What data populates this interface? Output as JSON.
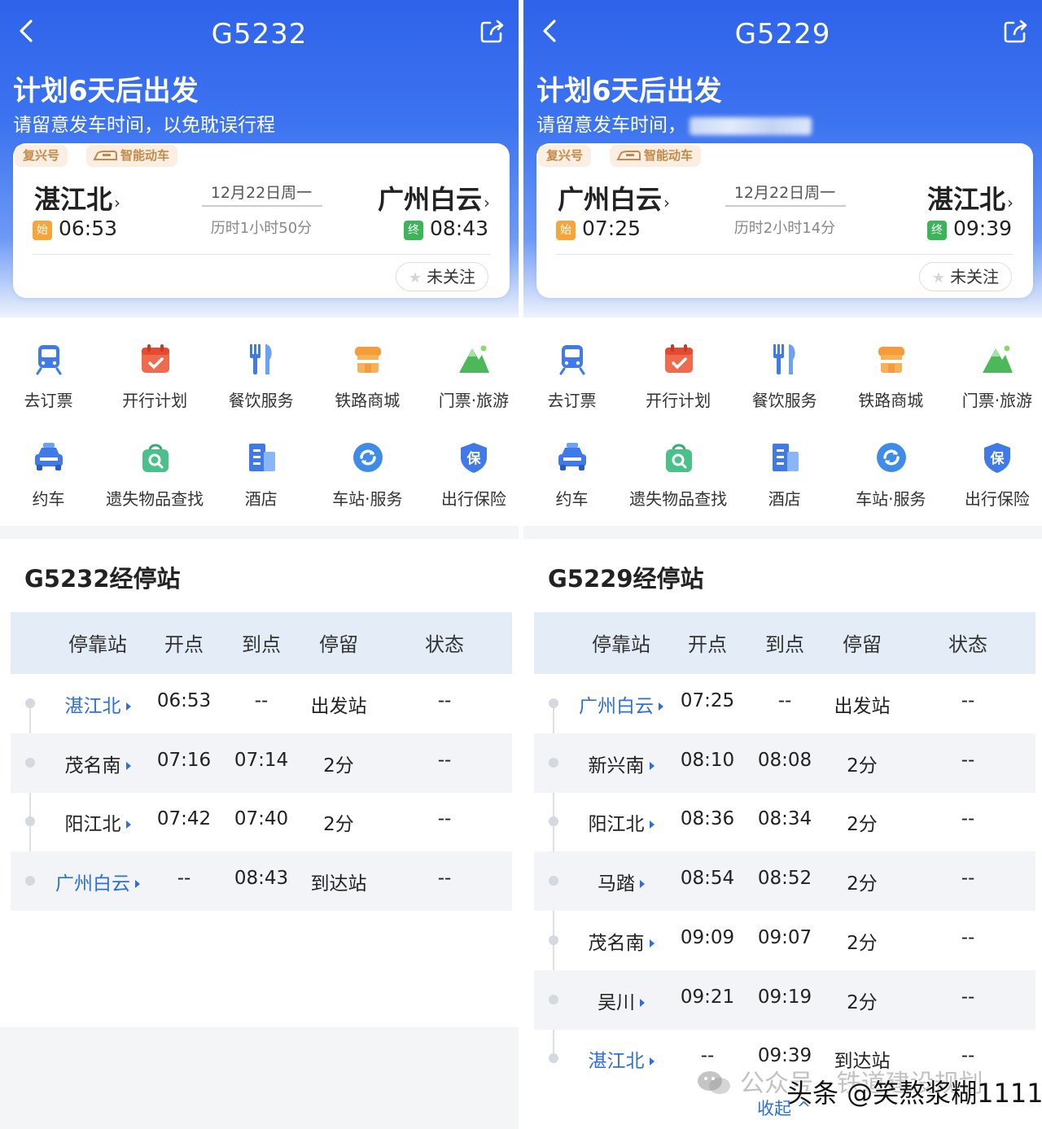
{
  "panels": [
    {
      "train_no": "G5232",
      "headline": "计划6天后出发",
      "subline": "请留意发车时间，以免耽误行程",
      "subline_blurred": false,
      "tags": [
        "复兴号",
        "智能动车"
      ],
      "from_station": "湛江北",
      "to_station": "广州白云",
      "depart_badge": "始",
      "arrive_badge": "终",
      "depart_time": "06:53",
      "arrive_time": "08:43",
      "date": "12月22日周一",
      "duration": "历时1小时50分",
      "follow_label": "未关注",
      "services": [
        "去订票",
        "开行计划",
        "餐饮服务",
        "铁路商城",
        "门票·旅游",
        "约车",
        "遗失物品查找",
        "酒店",
        "车站·服务",
        "出行保险"
      ],
      "stops_title": "G5232经停站",
      "table_headers": [
        "停靠站",
        "开点",
        "到点",
        "停留",
        "状态"
      ],
      "stops": [
        {
          "name": "湛江北",
          "depart": "06:53",
          "arrive": "--",
          "stay": "出发站",
          "status": "--",
          "highlight": true
        },
        {
          "name": "茂名南",
          "depart": "07:16",
          "arrive": "07:14",
          "stay": "2分",
          "status": "--",
          "highlight": false
        },
        {
          "name": "阳江北",
          "depart": "07:42",
          "arrive": "07:40",
          "stay": "2分",
          "status": "--",
          "highlight": false
        },
        {
          "name": "广州白云",
          "depart": "--",
          "arrive": "08:43",
          "stay": "到达站",
          "status": "--",
          "highlight": true
        }
      ]
    },
    {
      "train_no": "G5229",
      "headline": "计划6天后出发",
      "subline": "请留意发车时间，",
      "subline_blurred": true,
      "tags": [
        "复兴号",
        "智能动车"
      ],
      "from_station": "广州白云",
      "to_station": "湛江北",
      "depart_badge": "始",
      "arrive_badge": "终",
      "depart_time": "07:25",
      "arrive_time": "09:39",
      "date": "12月22日周一",
      "duration": "历时2小时14分",
      "follow_label": "未关注",
      "services": [
        "去订票",
        "开行计划",
        "餐饮服务",
        "铁路商城",
        "门票·旅游",
        "约车",
        "遗失物品查找",
        "酒店",
        "车站·服务",
        "出行保险"
      ],
      "stops_title": "G5229经停站",
      "table_headers": [
        "停靠站",
        "开点",
        "到点",
        "停留",
        "状态"
      ],
      "stops": [
        {
          "name": "广州白云",
          "depart": "07:25",
          "arrive": "--",
          "stay": "出发站",
          "status": "--",
          "highlight": true
        },
        {
          "name": "新兴南",
          "depart": "08:10",
          "arrive": "08:08",
          "stay": "2分",
          "status": "--",
          "highlight": false
        },
        {
          "name": "阳江北",
          "depart": "08:36",
          "arrive": "08:34",
          "stay": "2分",
          "status": "--",
          "highlight": false
        },
        {
          "name": "马踏",
          "depart": "08:54",
          "arrive": "08:52",
          "stay": "2分",
          "status": "--",
          "highlight": false
        },
        {
          "name": "茂名南",
          "depart": "09:09",
          "arrive": "09:07",
          "stay": "2分",
          "status": "--",
          "highlight": false
        },
        {
          "name": "吴川",
          "depart": "09:21",
          "arrive": "09:19",
          "stay": "2分",
          "status": "--",
          "highlight": false
        },
        {
          "name": "湛江北",
          "depart": "--",
          "arrive": "09:39",
          "stay": "到达站",
          "status": "--",
          "highlight": true
        }
      ],
      "collapse_label": "收起 ^"
    }
  ],
  "watermark": "公众号 · 铁道建设规划",
  "credit": "头条 @笑熬浆糊1111",
  "colors": {
    "brand_blue": "#2e63ea",
    "link_blue": "#2f6fd9",
    "start_badge": "#f5a53a",
    "end_badge": "#3cb55a"
  }
}
